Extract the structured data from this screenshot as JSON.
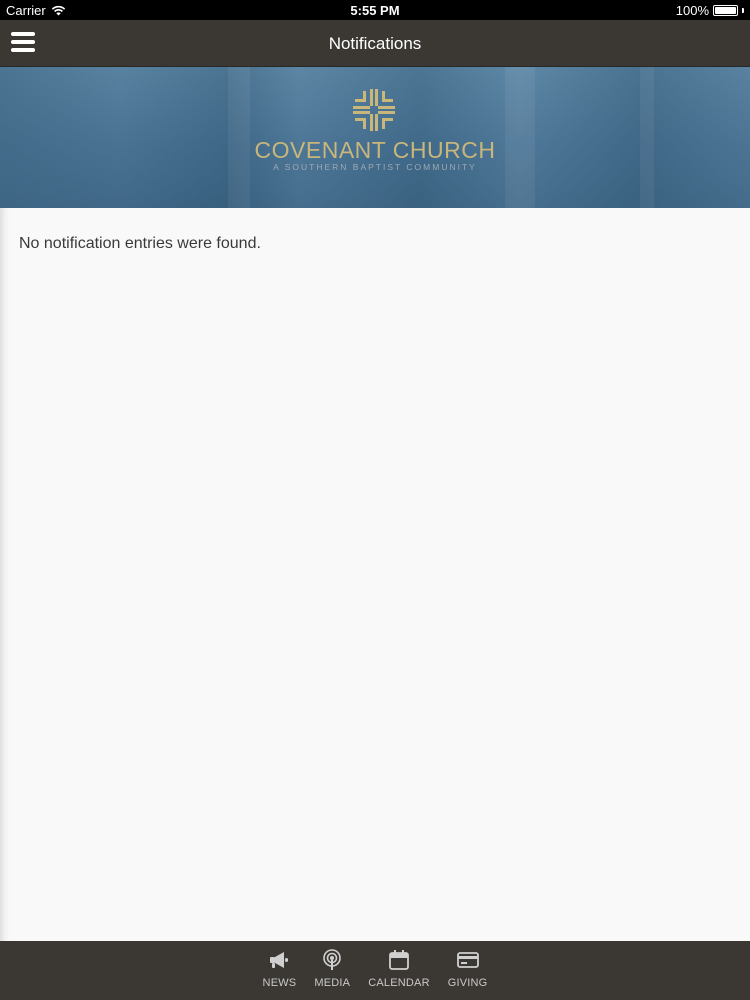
{
  "status_bar": {
    "carrier": "Carrier",
    "time": "5:55 PM",
    "battery": "100%",
    "battery_level": 1.0
  },
  "nav": {
    "title": "Notifications",
    "menu_icon": "hamburger-menu-icon"
  },
  "banner": {
    "logo_icon": "cross-logo-icon",
    "name": "COVENANT CHURCH",
    "tagline": "A SOUTHERN BAPTIST COMMUNITY"
  },
  "content": {
    "empty_message": "No notification entries were found."
  },
  "tabs": [
    {
      "label": "NEWS",
      "icon": "megaphone-icon"
    },
    {
      "label": "MEDIA",
      "icon": "podcast-icon"
    },
    {
      "label": "CALENDAR",
      "icon": "calendar-icon"
    },
    {
      "label": "GIVING",
      "icon": "credit-card-icon"
    }
  ],
  "colors": {
    "nav_background": "#3b3834",
    "logo_gold": "#c8b67a",
    "content_background": "#f9f9fa"
  }
}
